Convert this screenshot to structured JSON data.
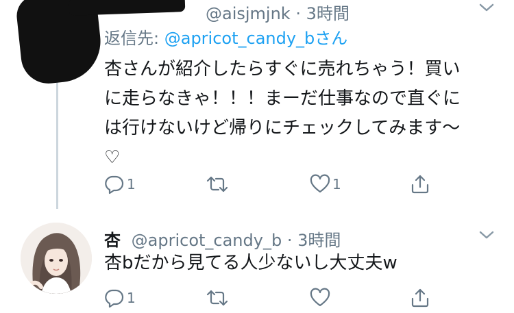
{
  "tweets": [
    {
      "author_handle": "@aisjmjnk",
      "time": "3時間",
      "reply_label": "返信先:",
      "reply_mention": "@apricot_candy_bさん",
      "body_lines": [
        "杏さんが紹介したらすぐに売れちゃう！買い",
        "に走らなきゃ！！！まーだ仕事なので直ぐに",
        "は行けないけど帰りにチェックしてみます〜",
        "♡"
      ],
      "reply_count": "1",
      "retweet_count": "",
      "like_count": "1"
    },
    {
      "author_name": "杏",
      "author_handle": "@apricot_candy_b",
      "time": "3時間",
      "body_lines": [
        "杏bだから見てる人少ないし大丈夫w"
      ],
      "reply_count": "1",
      "retweet_count": "",
      "like_count": ""
    }
  ],
  "colors": {
    "text": "#14171a",
    "muted": "#657786",
    "link": "#1da1f2",
    "thread_line": "#ccd6dd"
  },
  "icons": {
    "reply": "reply-icon",
    "retweet": "retweet-icon",
    "like": "heart-icon",
    "share": "share-icon",
    "more": "chevron-down-icon"
  }
}
